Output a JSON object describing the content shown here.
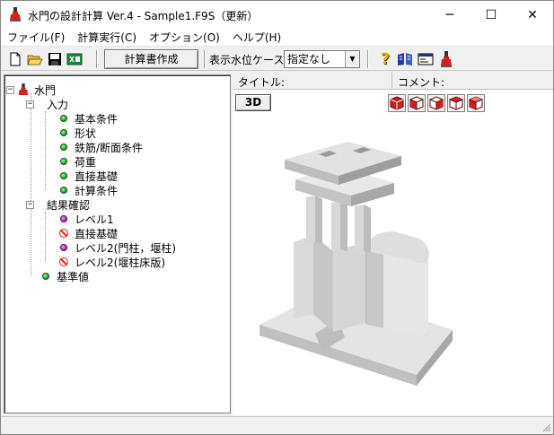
{
  "window": {
    "title": "水門の設計計算 Ver.4 - Sample1.F9S（更新）",
    "minimize": "─",
    "maximize": "☐",
    "close": "✕"
  },
  "menu": [
    {
      "label": "ファイル(F)"
    },
    {
      "label": "計算実行(C)"
    },
    {
      "label": "オプション(O)"
    },
    {
      "label": "ヘルプ(H)"
    }
  ],
  "toolbar": {
    "new_icon": "new-file-icon",
    "open_icon": "open-folder-icon",
    "save_icon": "save-icon",
    "export_icon": "export-icon",
    "report_button": "計算書作成",
    "water_level_label": "表示水位ケース",
    "water_level_value": "指定なし",
    "help_icon": "help-icon",
    "book_icon": "manual-icon",
    "card_icon": "card-icon",
    "app_icon": "app-icon"
  },
  "tree": {
    "root": "水門",
    "input": {
      "label": "入力",
      "items": [
        "基本条件",
        "形状",
        "鉄筋/断面条件",
        "荷重",
        "直接基礎",
        "計算条件"
      ]
    },
    "result": {
      "label": "結果確認",
      "items": [
        {
          "label": "レベル1",
          "status": "purple"
        },
        {
          "label": "直接基礎",
          "status": "prohibited"
        },
        {
          "label": "レベル2(門柱，堰柱)",
          "status": "purple"
        },
        {
          "label": "レベル2(堰柱床版)",
          "status": "prohibited"
        }
      ]
    },
    "standard": "基準値",
    "expander_minus": "−"
  },
  "right": {
    "title_label": "タイトル:",
    "comment_label": "コメント:",
    "view_3d": "3D",
    "view_buttons": [
      "iso-view-1",
      "iso-view-2",
      "iso-view-3",
      "iso-view-4",
      "iso-view-5"
    ]
  },
  "colors": {
    "accent_red": "#d02020",
    "model_light": "#e6e6e6",
    "model_mid": "#c8c8c8",
    "model_dark": "#9a9a9a"
  }
}
